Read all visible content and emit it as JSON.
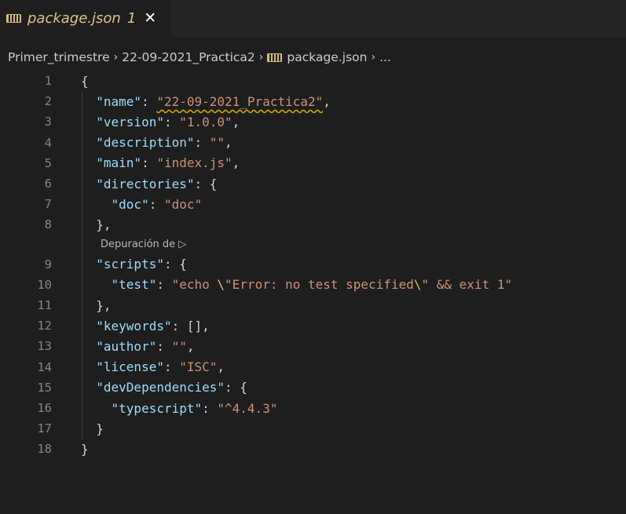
{
  "tab": {
    "title": "package.json",
    "problem_count": "1",
    "close_glyph": "✕"
  },
  "breadcrumb": {
    "items": [
      "Primer_trimestre",
      "22-09-2021_Practica2",
      "package.json",
      "..."
    ],
    "separator": "›"
  },
  "codelens": {
    "label": "Depuración de ▷"
  },
  "editor": {
    "lines": [
      {
        "n": "1",
        "text": "{"
      },
      {
        "n": "2",
        "text": "  \"name\": \"22-09-2021_Practica2\","
      },
      {
        "n": "3",
        "text": "  \"version\": \"1.0.0\","
      },
      {
        "n": "4",
        "text": "  \"description\": \"\","
      },
      {
        "n": "5",
        "text": "  \"main\": \"index.js\","
      },
      {
        "n": "6",
        "text": "  \"directories\": {"
      },
      {
        "n": "7",
        "text": "    \"doc\": \"doc\""
      },
      {
        "n": "8",
        "text": "  },"
      },
      {
        "n": "9",
        "text": "  \"scripts\": {"
      },
      {
        "n": "10",
        "text": "    \"test\": \"echo \\\"Error: no test specified\\\" && exit 1\""
      },
      {
        "n": "11",
        "text": "  },"
      },
      {
        "n": "12",
        "text": "  \"keywords\": [],"
      },
      {
        "n": "13",
        "text": "  \"author\": \"\","
      },
      {
        "n": "14",
        "text": "  \"license\": \"ISC\","
      },
      {
        "n": "15",
        "text": "  \"devDependencies\": {"
      },
      {
        "n": "16",
        "text": "    \"typescript\": \"^4.4.3\""
      },
      {
        "n": "17",
        "text": "  }"
      },
      {
        "n": "18",
        "text": "}"
      }
    ]
  },
  "colors": {
    "background": "#1e1e1e",
    "key": "#9cdcfe",
    "string": "#ce9178",
    "line_number": "#858585",
    "warning_squiggle": "#cca700",
    "tab_title": "#e2c08d"
  }
}
